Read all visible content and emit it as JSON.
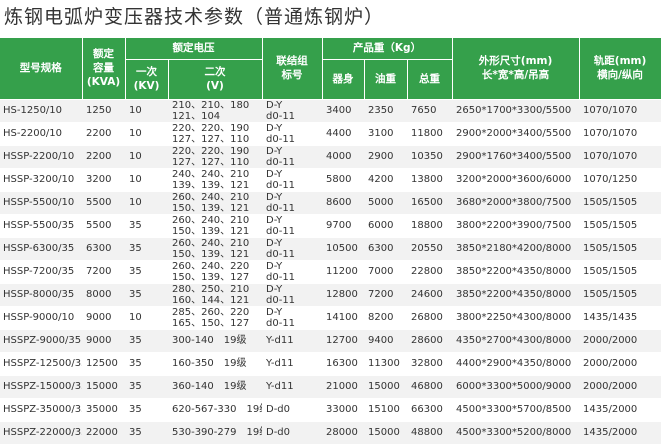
{
  "title": "炼钢电弧炉变压器技术参数（普通炼钢炉）",
  "headers": {
    "model": "型号规格",
    "capacity": "额定容量（KVA）",
    "capacity_l1": "额定",
    "capacity_l2": "容量",
    "capacity_l3": "(KVA)",
    "rated_voltage": "额定电压",
    "primary": "一次",
    "primary_unit": "(KV)",
    "secondary": "二次",
    "secondary_unit": "(V)",
    "connection_l1": "联结组",
    "connection_l2": "标号",
    "weight": "产品重（Kg）",
    "weight_group": "产品重（Kg）",
    "body": "器身",
    "oil": "油重",
    "total": "总重",
    "dims_l1": "外形尺寸(mm)",
    "dims_l2": "长*宽*高/吊高",
    "gauge_l1": "轨距(mm)",
    "gauge_l2": "横向/纵向"
  },
  "rows": [
    {
      "model": "HS-1250/10",
      "capacity": "1250",
      "primary": "10",
      "sec1": "210、210、180",
      "sec2": "121、104",
      "conn1": "D-Y",
      "conn2": "d0-11",
      "body": "3400",
      "oil": "2350",
      "total": "7650",
      "dims": "2650*1700*3300/5500",
      "gauge": "1070/1070"
    },
    {
      "model": "HS-2200/10",
      "capacity": "2200",
      "primary": "10",
      "sec1": "220、220、190",
      "sec2": "127、127、110",
      "conn1": "D-Y",
      "conn2": "d0-11",
      "body": "4400",
      "oil": "3100",
      "total": "11800",
      "dims": "2900*2000*3400/5500",
      "gauge": "1070/1070"
    },
    {
      "model": "HSSP-2200/10",
      "capacity": "2200",
      "primary": "10",
      "sec1": "220、220、190",
      "sec2": "127、127、110",
      "conn1": "D-Y",
      "conn2": "d0-11",
      "body": "4000",
      "oil": "2900",
      "total": "10350",
      "dims": "2900*1760*3400/5500",
      "gauge": "1070/1070"
    },
    {
      "model": "HSSP-3200/10",
      "capacity": "3200",
      "primary": "10",
      "sec1": "240、240、210",
      "sec2": "139、139、121",
      "conn1": "D-Y",
      "conn2": "d0-11",
      "body": "5800",
      "oil": "4200",
      "total": "13800",
      "dims": "3200*2000*3600/6000",
      "gauge": "1070/1250"
    },
    {
      "model": "HSSP-5500/10",
      "capacity": "5500",
      "primary": "10",
      "sec1": "260、240、210",
      "sec2": "150、139、121",
      "conn1": "D-Y",
      "conn2": "d0-11",
      "body": "8600",
      "oil": "5000",
      "total": "16500",
      "dims": "3680*2000*3800/7500",
      "gauge": "1505/1505"
    },
    {
      "model": "HSSP-5500/35",
      "capacity": "5500",
      "primary": "35",
      "sec1": "260、240、210",
      "sec2": "150、139、121",
      "conn1": "D-Y",
      "conn2": "d0-11",
      "body": "9700",
      "oil": "6000",
      "total": "18800",
      "dims": "3800*2200*3900/7500",
      "gauge": "1505/1505"
    },
    {
      "model": "HSSP-6300/35",
      "capacity": "6300",
      "primary": "35",
      "sec1": "260、240、210",
      "sec2": "150、139、121",
      "conn1": "D-Y",
      "conn2": "d0-11",
      "body": "10500",
      "oil": "6300",
      "total": "20550",
      "dims": "3850*2180*4200/8000",
      "gauge": "1505/1505"
    },
    {
      "model": "HSSP-7200/35",
      "capacity": "7200",
      "primary": "35",
      "sec1": "260、240、220",
      "sec2": "150、139、127",
      "conn1": "D-Y",
      "conn2": "d0-11",
      "body": "11200",
      "oil": "7000",
      "total": "22800",
      "dims": "3850*2200*4350/8000",
      "gauge": "1505/1505"
    },
    {
      "model": "HSSP-8000/35",
      "capacity": "8000",
      "primary": "35",
      "sec1": "280、250、210",
      "sec2": "160、144、121",
      "conn1": "D-Y",
      "conn2": "d0-11",
      "body": "12800",
      "oil": "7200",
      "total": "24600",
      "dims": "3850*2200*4350/8000",
      "gauge": "1505/1505"
    },
    {
      "model": "HSSP-9000/10",
      "capacity": "9000",
      "primary": "10",
      "sec1": "285、260、220",
      "sec2": "165、150、127",
      "conn1": "D-Y",
      "conn2": "d0-11",
      "body": "14100",
      "oil": "8200",
      "total": "26800",
      "dims": "3800*2250*4300/8000",
      "gauge": "1435/1435"
    },
    {
      "model": "HSSPZ-9000/35",
      "capacity": "9000",
      "primary": "35",
      "sec1": "300-140　19级",
      "sec2": "",
      "conn1": "Y-d11",
      "conn2": "",
      "body": "12700",
      "oil": "9400",
      "total": "28600",
      "dims": "4350*2700*4300/8000",
      "gauge": "2000/2000"
    },
    {
      "model": "HSSPZ-12500/35",
      "capacity": "12500",
      "primary": "35",
      "sec1": "160-350　19级",
      "sec2": "",
      "conn1": "Y-d11",
      "conn2": "",
      "body": "16300",
      "oil": "11300",
      "total": "32800",
      "dims": "4400*2900*4350/8000",
      "gauge": "2000/2000"
    },
    {
      "model": "HSSPZ-15000/35",
      "capacity": "15000",
      "primary": "35",
      "sec1": "360-140　19级",
      "sec2": "",
      "conn1": "Y-d11",
      "conn2": "",
      "body": "21000",
      "oil": "15000",
      "total": "46800",
      "dims": "6000*3300*5000/9000",
      "gauge": "2000/2000"
    },
    {
      "model": "HSSPZ-35000/35",
      "capacity": "35000",
      "primary": "35",
      "sec1": "620-567-330　19级",
      "sec2": "",
      "conn1": "D-d0",
      "conn2": "",
      "body": "33000",
      "oil": "15100",
      "total": "66300",
      "dims": "4500*3300*5700/8500",
      "gauge": "1435/2000"
    },
    {
      "model": "HSSPZ-22000/35",
      "capacity": "22000",
      "primary": "35",
      "sec1": "530-390-279　19级",
      "sec2": "",
      "conn1": "D-d0",
      "conn2": "",
      "body": "28000",
      "oil": "15000",
      "total": "48800",
      "dims": "4500*3300*5200/8000",
      "gauge": "1435/2000"
    }
  ]
}
